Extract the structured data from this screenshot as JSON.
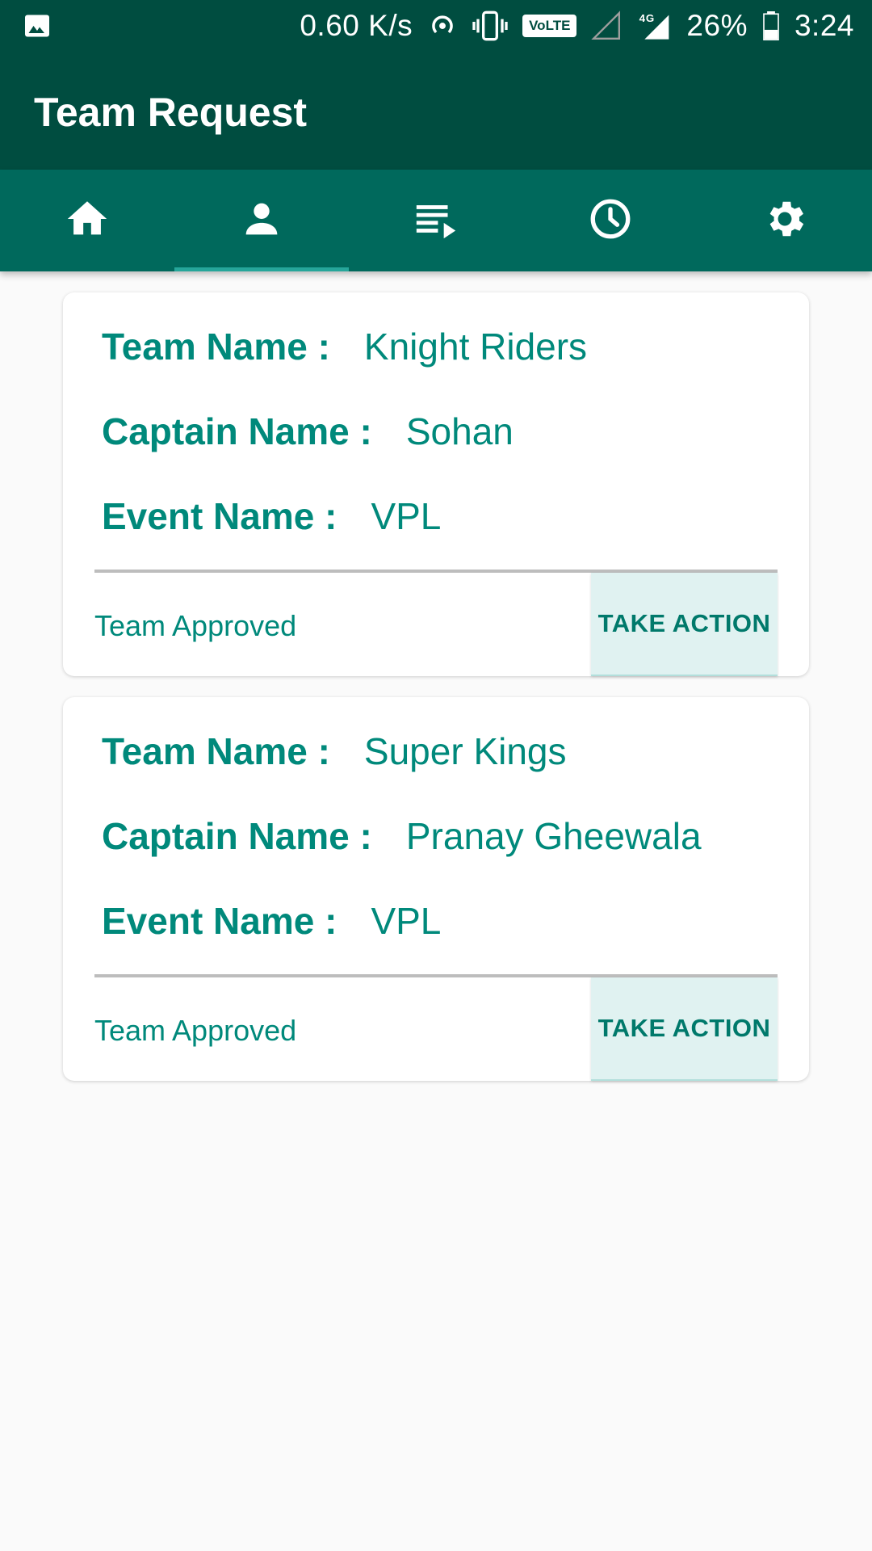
{
  "status_bar": {
    "net_speed": "0.60 K/s",
    "volte": "VoLTE",
    "network": "4G",
    "battery": "26%",
    "time": "3:24"
  },
  "app_bar": {
    "title": "Team Request"
  },
  "tabs": [
    {
      "icon": "home-icon",
      "active": false
    },
    {
      "icon": "person-icon",
      "active": true
    },
    {
      "icon": "playlist-icon",
      "active": false
    },
    {
      "icon": "clock-icon",
      "active": false
    },
    {
      "icon": "gear-icon",
      "active": false
    }
  ],
  "cards": [
    {
      "team_label": "Team Name :",
      "team_value": "Knight Riders",
      "captain_label": "Captain Name :",
      "captain_value": "Sohan",
      "event_label": "Event Name :",
      "event_value": "VPL",
      "status": "Team Approved",
      "action": "TAKE ACTION"
    },
    {
      "team_label": "Team Name :",
      "team_value": "Super Kings",
      "captain_label": "Captain Name :",
      "captain_value": "Pranay Gheewala",
      "event_label": "Event Name :",
      "event_value": "VPL",
      "status": "Team Approved",
      "action": "TAKE ACTION"
    }
  ],
  "colors": {
    "primary_dark": "#004d40",
    "primary": "#00695c",
    "accent_text": "#00897b",
    "button_bg": "#e0f2f1"
  }
}
